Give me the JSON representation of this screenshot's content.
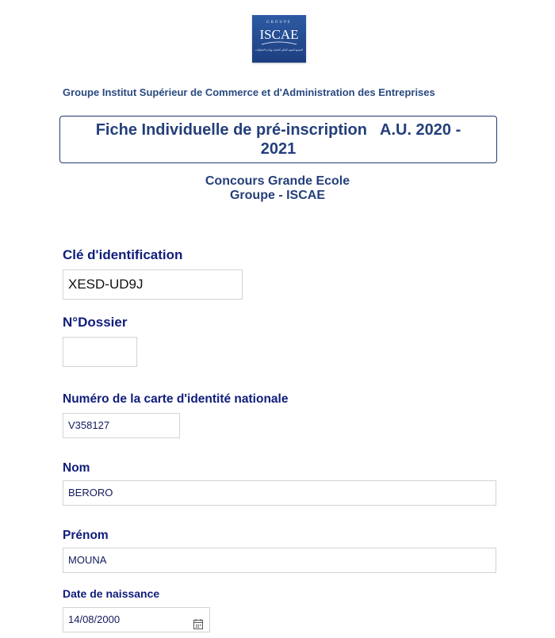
{
  "logo": {
    "top_text": "GROUPE",
    "main_text": "ISCAE",
    "arabic_text": "المجمع المعهد العالي للتجارة وإدارة المقاولات"
  },
  "header": {
    "institute_name": "Groupe Institut Supérieur de Commerce et d'Administration des Entreprises",
    "form_title_line1": "Fiche Individuelle de pré-inscription",
    "form_title_year_part1": "A.U.  2020 -",
    "form_title_line2": "2021",
    "subtitle_line1": "Concours Grande Ecole",
    "subtitle_line2": "Groupe - ISCAE"
  },
  "form": {
    "cle_label": "Clé d'identification",
    "cle_value": "XESD-UD9J",
    "dossier_label": "N°Dossier",
    "dossier_value": "",
    "cin_label": "Numéro de la carte d'identité nationale",
    "cin_value": "V358127",
    "nom_label": "Nom",
    "nom_value": "BERORO",
    "prenom_label": "Prénom",
    "prenom_value": "MOUNA",
    "date_label": "Date de naissance",
    "date_value": "14/08/2000",
    "date_icon": "calendar-icon"
  },
  "colors": {
    "label_color": "#0f1d7a",
    "heading_color": "#243f7a",
    "logo_bg": "#1d3f80"
  }
}
